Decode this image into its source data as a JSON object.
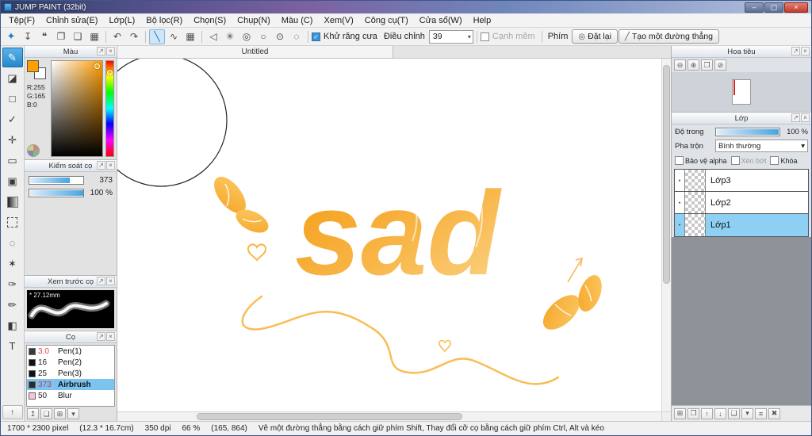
{
  "colors": {
    "accent_blue": "#2f96dc",
    "selection_blue": "#8ed0f4",
    "artwork_orange_dark": "#f29a0e",
    "artwork_orange_light": "#fdd58b",
    "foreground_color": "#ff9f00"
  },
  "window": {
    "title": "JUMP PAINT (32bit)"
  },
  "icons": {
    "window_minimize": "–",
    "window_maximize": "▢",
    "window_close": "×",
    "panel_popout": "↗",
    "panel_close": "×",
    "tb_brush": "✦",
    "tb_save": "↧",
    "tb_comment": "❝",
    "tb_palette": "❐",
    "tb_pages": "❑",
    "tb_grid": "▦",
    "tb_undo": "↶",
    "tb_redo": "↷",
    "tb_line": "╲",
    "tb_curve": "∿",
    "tb_grid2": "▦",
    "tb_arrow": "◁",
    "tb_snap": "✳",
    "tb_concentric": "◎",
    "tb_circle": "○",
    "tb_dotted": "⊙",
    "tb_ellipse": "◌",
    "combo_arrow": "▾",
    "btn_reset_icon": "◎",
    "btn_line_icon": "╱",
    "tool_brush": "✎",
    "tool_eraser": "◪",
    "tool_shape": "□",
    "tool_ctrl": "✓",
    "tool_move": "✛",
    "tool_select": "▭",
    "tool_fill": "▣",
    "tool_lasso": "◌",
    "tool_wand": "✶",
    "tool_eyedropper": "✑",
    "tool_pen": "✏",
    "tool_rotate": "◧",
    "tool_text": "T",
    "tool_collapse": "↑",
    "nav_zoom_out": "⊖",
    "nav_zoom_in": "⊕",
    "nav_fit": "❒",
    "nav_reset": "⊘",
    "layer_new": "⊞",
    "layer_folder": "❒",
    "layer_up": "↑",
    "layer_down": "↓",
    "layer_dup": "❑",
    "layer_merge": "▾",
    "layer_menu": "≡",
    "layer_delete": "✖",
    "brush_up": "↥",
    "brush_page": "❏",
    "brush_new": "⊞",
    "brush_menu": "▾",
    "visibility_dot": "●"
  },
  "menubar": {
    "items": [
      "Tệp(F)",
      "Chỉnh sửa(E)",
      "Lớp(L)",
      "Bộ lọc(R)",
      "Chọn(S)",
      "Chụp(N)",
      "Màu (C)",
      "Xem(V)",
      "Công cụ(T)",
      "Cửa sổ(W)",
      "Help"
    ]
  },
  "toolbar": {
    "antialias": "Khử răng cưa",
    "adjust": "Điều chỉnh",
    "adjust_value": "39",
    "soft_edge": "Cạnh mềm",
    "key_label": "Phím",
    "reset": "Đặt lại",
    "straight_line": "Tạo một đường thẳng"
  },
  "color_panel": {
    "title": "Màu",
    "r": "R:255",
    "g": "G:165",
    "b": "B:0"
  },
  "brush_control": {
    "title": "Kiểm soát cọ",
    "size_value": "373",
    "opacity_value": "100 %"
  },
  "brush_preview": {
    "title": "Xem trước cọ",
    "size_label": "* 27.12mm"
  },
  "brushes": {
    "title": "Cọ",
    "items": [
      {
        "size": "3.0",
        "name": "Pen(1)",
        "size_color": "#e04848",
        "swatch": "#3a3a3a"
      },
      {
        "size": "16",
        "name": "Pen(2)",
        "size_color": "#222222",
        "swatch": "#111111"
      },
      {
        "size": "25",
        "name": "Pen(3)",
        "size_color": "#222222",
        "swatch": "#111111"
      },
      {
        "size": "373",
        "name": "Airbrush",
        "size_color": "#c23a5a",
        "swatch": "#2a2a2a",
        "selected": true
      },
      {
        "size": "50",
        "name": "Blur",
        "size_color": "#222222",
        "swatch": "#f5c6d8"
      }
    ]
  },
  "canvas": {
    "tab": "Untitled",
    "artwork_word": "sad"
  },
  "navigator": {
    "title": "Hoa tiêu"
  },
  "layers": {
    "title": "Lớp",
    "opacity_label": "Độ trong",
    "opacity_value": "100 %",
    "blend_label": "Pha trộn",
    "blend_value": "Bình thường",
    "protect_alpha": "Bảo vệ alpha",
    "clipping": "Xén bớt",
    "lock": "Khóa",
    "items": [
      {
        "name": "Lớp3"
      },
      {
        "name": "Lớp2"
      },
      {
        "name": "Lớp1",
        "selected": true
      }
    ]
  },
  "statusbar": {
    "dimensions": "1700 * 2300 pixel",
    "size_cm": "(12.3 * 16.7cm)",
    "dpi": "350 dpi",
    "zoom": "66 %",
    "cursor": "(165, 864)",
    "hint": "Vẽ một đường thẳng bằng cách giữ phím Shift, Thay đổi cỡ cọ bằng cách giữ phím Ctrl, Alt và kéo"
  }
}
